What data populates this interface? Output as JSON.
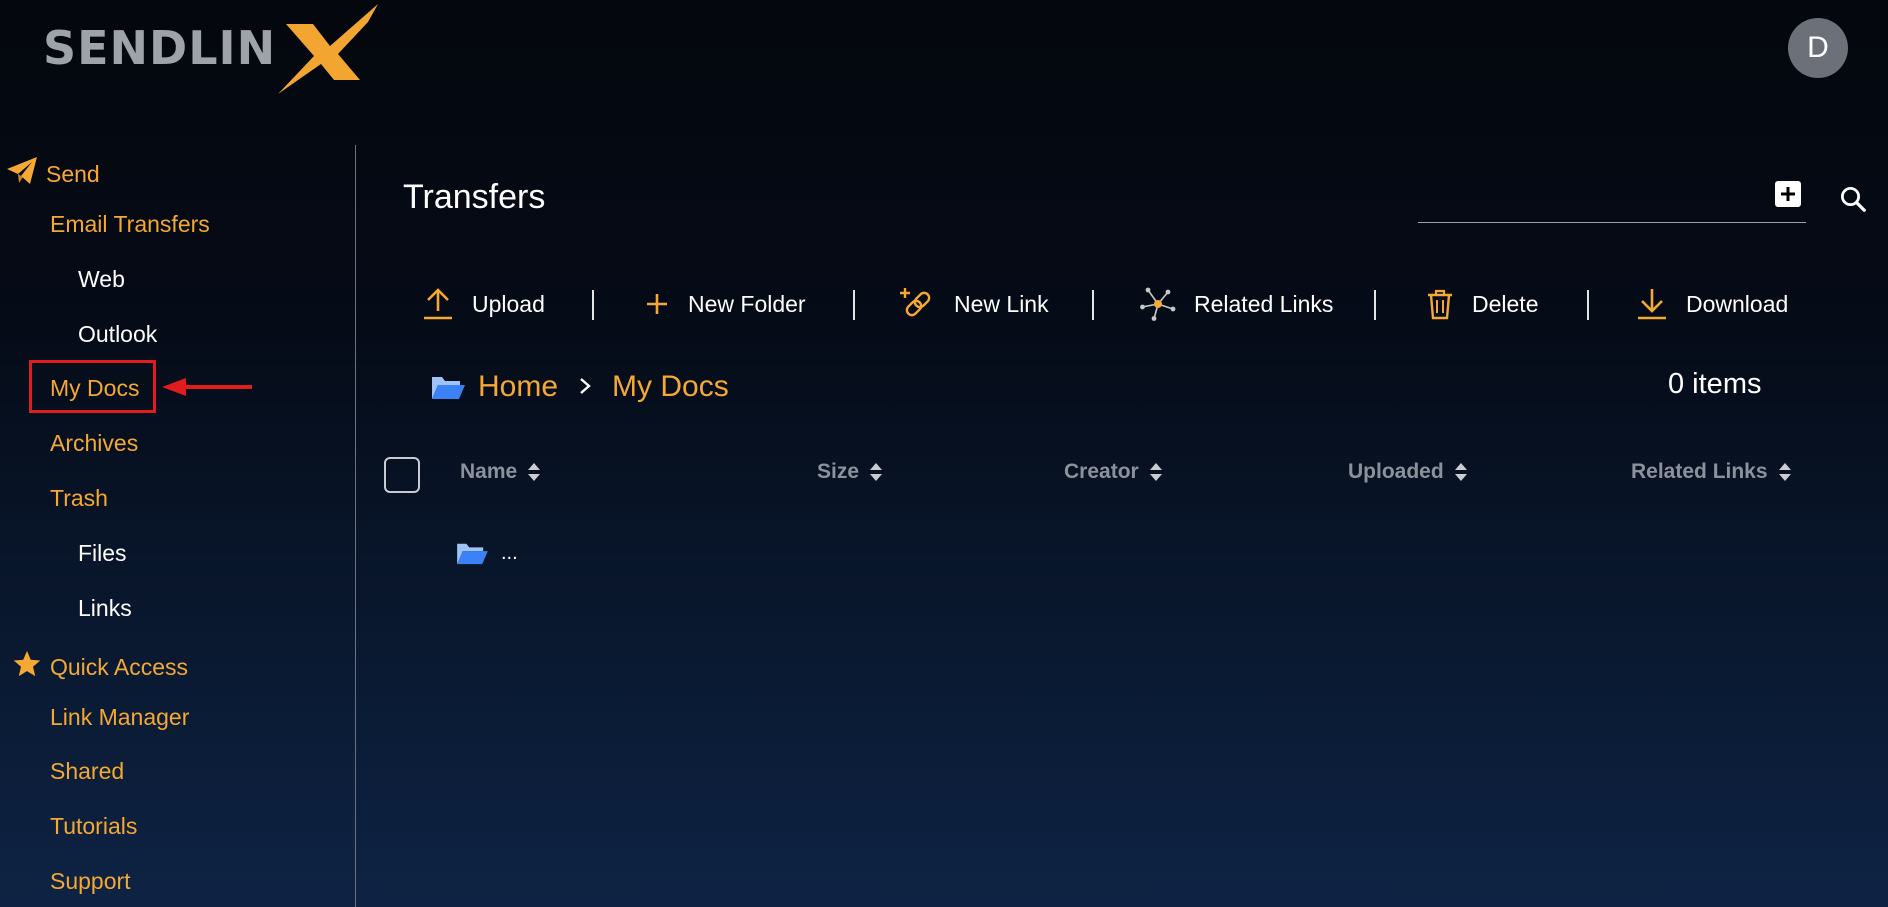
{
  "brand": {
    "name": "SENDLINX",
    "accent": "#f5a833"
  },
  "user": {
    "avatar_letter": "D"
  },
  "sidebar": {
    "send": {
      "label": "Send",
      "icon": "paper-plane-icon"
    },
    "email_transfers": "Email Transfers",
    "web": "Web",
    "outlook": "Outlook",
    "my_docs": "My Docs",
    "archives": "Archives",
    "trash": "Trash",
    "files": "Files",
    "links": "Links",
    "quick_access": {
      "label": "Quick Access",
      "icon": "star-icon"
    },
    "link_manager": "Link Manager",
    "shared": "Shared",
    "tutorials": "Tutorials",
    "support": "Support"
  },
  "main": {
    "title": "Transfers",
    "search": {
      "placeholder": ""
    },
    "toolbar": {
      "upload": "Upload",
      "new_folder": "New Folder",
      "new_link": "New Link",
      "related_links": "Related Links",
      "delete": "Delete",
      "download": "Download"
    },
    "breadcrumb": {
      "home": "Home",
      "current": "My Docs"
    },
    "items_count": "0 items",
    "columns": {
      "name": "Name",
      "size": "Size",
      "creator": "Creator",
      "uploaded": "Uploaded",
      "related_links": "Related Links"
    },
    "rows": [
      {
        "label": "..."
      }
    ]
  },
  "colors": {
    "accent_orange": "#f5a833",
    "highlight_red": "#e11c1c",
    "folder_blue": "#3b82f6"
  }
}
